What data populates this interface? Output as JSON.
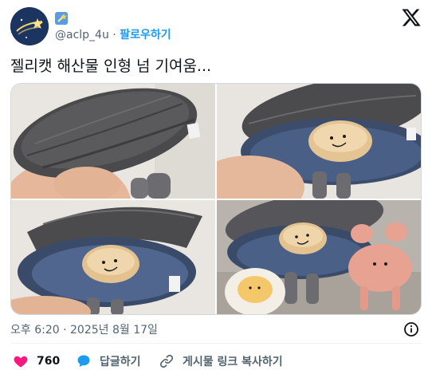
{
  "author": {
    "handle": "@aclp_4u",
    "separator": "·",
    "follow_label": "팔로우하기"
  },
  "tweet": {
    "text": "젤리캣 해산물 인형 넘 기여움..."
  },
  "media": {
    "count": 4
  },
  "meta": {
    "timestamp": "오후 6:20 · 2025년 8월 17일"
  },
  "actions": {
    "like_count": "760",
    "reply_label": "답글하기",
    "copy_link_label": "게시물 링크 복사하기"
  },
  "colors": {
    "accent": "#1d9bf0",
    "like": "#f91880",
    "muted": "#536471",
    "text": "#0f1419"
  },
  "icons": {
    "brand": "x-logo-icon",
    "like": "heart-icon",
    "reply": "speech-bubble-icon",
    "copy": "link-icon",
    "info": "info-icon"
  }
}
